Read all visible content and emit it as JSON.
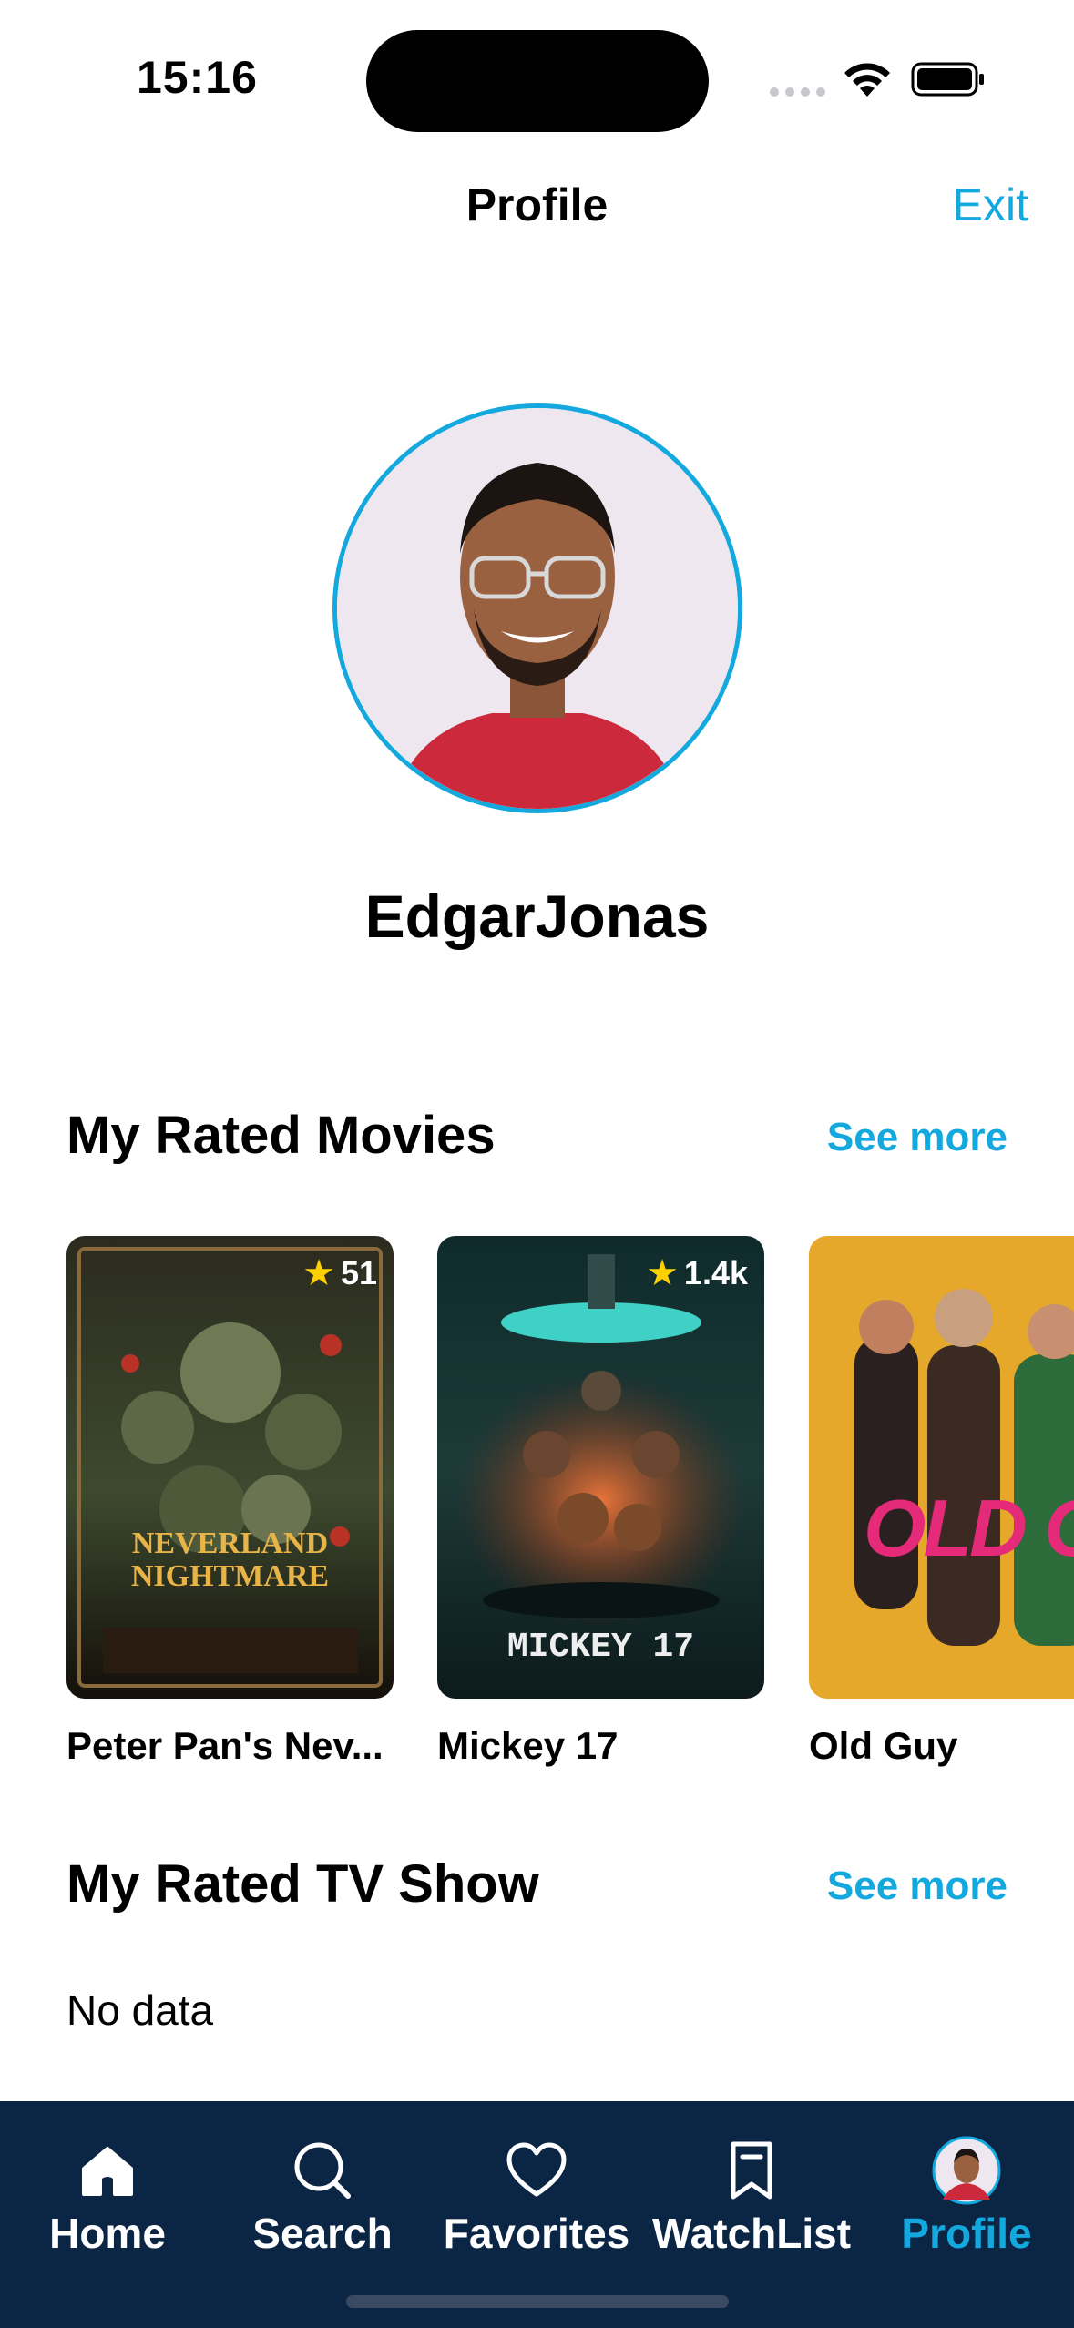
{
  "status_bar": {
    "time": "15:16"
  },
  "nav": {
    "title": "Profile",
    "exit_label": "Exit"
  },
  "profile": {
    "username": "EdgarJonas"
  },
  "rated_movies": {
    "title": "My Rated Movies",
    "see_more": "See more",
    "items": [
      {
        "title": "Peter Pan's Nev...",
        "rating": "51",
        "poster_text": "NEVERLAND NIGHTMARE"
      },
      {
        "title": "Mickey 17",
        "rating": "1.4k",
        "poster_text": "MICKEY 17"
      },
      {
        "title": "Old Guy",
        "rating": "",
        "poster_text": "OLD GUY"
      }
    ]
  },
  "rated_tv": {
    "title": "My Rated TV Show",
    "see_more": "See more",
    "empty_text": "No data"
  },
  "tabbar": {
    "items": [
      {
        "label": "Home",
        "icon": "home-icon"
      },
      {
        "label": "Search",
        "icon": "search-icon"
      },
      {
        "label": "Favorites",
        "icon": "heart-icon"
      },
      {
        "label": "WatchList",
        "icon": "bookmark-icon"
      },
      {
        "label": "Profile",
        "icon": "avatar-icon"
      }
    ],
    "active": "Profile"
  },
  "colors": {
    "accent": "#14a9de",
    "tabbar_bg": "#0b2545",
    "star": "#ffd000"
  }
}
